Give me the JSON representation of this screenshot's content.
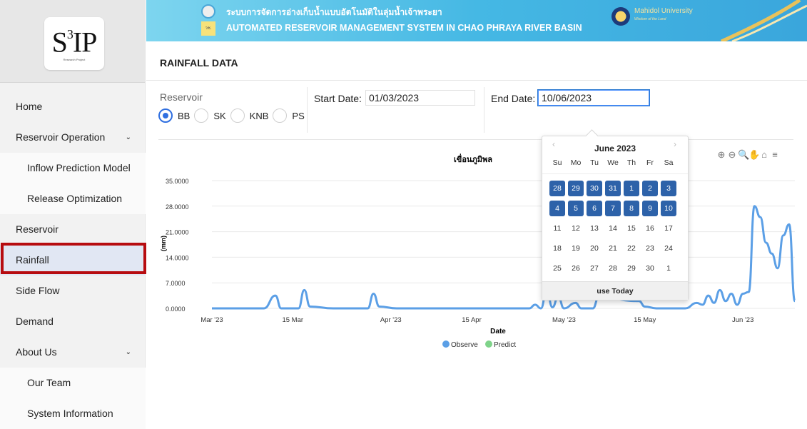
{
  "sidebar": {
    "logo_main": "S",
    "logo_sup": "3",
    "logo_rest": "IP",
    "logo_sub": "Research Project",
    "items": [
      {
        "label": "Home"
      },
      {
        "label": "Reservoir Operation",
        "chevron": "chevron-down-icon"
      },
      {
        "label": "Inflow Prediction Model"
      },
      {
        "label": "Release Optimization"
      },
      {
        "label": "Reservoir"
      },
      {
        "label": "Rainfall"
      },
      {
        "label": "Side Flow"
      },
      {
        "label": "Demand"
      },
      {
        "label": "About Us",
        "chevron": "chevron-down-icon"
      },
      {
        "label": "Our Team"
      },
      {
        "label": "System Information"
      }
    ],
    "active_item": "Rainfall",
    "highlight_color": "#b70c10"
  },
  "banner": {
    "title_th": "ระบบการจัดการอ่างเก็บน้ำแบบอัตโนมัติในลุ่มน้ำเจ้าพระยา",
    "title_en": "AUTOMATED RESERVOIR MANAGEMENT SYSTEM IN CHAO PHRAYA RIVER BASIN",
    "university": "Mahidol University",
    "university_sub": "Wisdom of the Land",
    "seal_text": "วช."
  },
  "page": {
    "title": "RAINFALL DATA"
  },
  "filters": {
    "reservoir_label": "Reservoir",
    "reservoirs": [
      "BB",
      "SK",
      "KNB",
      "PS"
    ],
    "selected_reservoir": "BB",
    "start_label": "Start Date:",
    "start_value": "01/03/2023",
    "end_label": "End Date:",
    "end_value": "10/06/2023"
  },
  "calendar": {
    "month_label": "June 2023",
    "prev": "‹",
    "next": "›",
    "weekdays": [
      "Su",
      "Mo",
      "Tu",
      "We",
      "Th",
      "Fr",
      "Sa"
    ],
    "days": [
      {
        "d": "28",
        "sel": true
      },
      {
        "d": "29",
        "sel": true
      },
      {
        "d": "30",
        "sel": true
      },
      {
        "d": "31",
        "sel": true
      },
      {
        "d": "1",
        "sel": true
      },
      {
        "d": "2",
        "sel": true
      },
      {
        "d": "3",
        "sel": true
      },
      {
        "d": "4",
        "sel": true
      },
      {
        "d": "5",
        "sel": true
      },
      {
        "d": "6",
        "sel": true
      },
      {
        "d": "7",
        "sel": true
      },
      {
        "d": "8",
        "sel": true
      },
      {
        "d": "9",
        "sel": true
      },
      {
        "d": "10",
        "sel": true
      },
      {
        "d": "11"
      },
      {
        "d": "12"
      },
      {
        "d": "13"
      },
      {
        "d": "14"
      },
      {
        "d": "15"
      },
      {
        "d": "16"
      },
      {
        "d": "17"
      },
      {
        "d": "18"
      },
      {
        "d": "19"
      },
      {
        "d": "20"
      },
      {
        "d": "21"
      },
      {
        "d": "22"
      },
      {
        "d": "23"
      },
      {
        "d": "24"
      },
      {
        "d": "25"
      },
      {
        "d": "26"
      },
      {
        "d": "27"
      },
      {
        "d": "28"
      },
      {
        "d": "29"
      },
      {
        "d": "30"
      },
      {
        "d": "1"
      }
    ],
    "today_label": "use Today",
    "selected_color": "#2d62a9"
  },
  "toolbar": {
    "icons": [
      "zoom-in-icon",
      "zoom-out-icon",
      "magnifier-icon",
      "pan-hand-icon",
      "home-icon",
      "menu-icon"
    ],
    "glyphs": [
      "⊕",
      "⊖",
      "🔍",
      "✋",
      "⌂",
      "≡"
    ]
  },
  "chart_data": {
    "type": "line",
    "title": "เขื่อนภูมิพล",
    "xlabel": "Date",
    "ylabel": "(mm)",
    "ylim": [
      0,
      35
    ],
    "yticks": [
      0,
      7,
      14,
      21,
      28,
      35
    ],
    "ytick_labels": [
      "0.0000",
      "7.0000",
      "14.0000",
      "21.0000",
      "28.0000",
      "35.0000"
    ],
    "xticks": [
      "2023-03-01",
      "2023-03-15",
      "2023-04-01",
      "2023-04-15",
      "2023-05-01",
      "2023-05-15",
      "2023-06-01"
    ],
    "xtick_labels": [
      "Mar '23",
      "15 Mar",
      "Apr '23",
      "15 Apr",
      "May '23",
      "15 May",
      "Jun '23"
    ],
    "xlim": [
      "2023-03-01",
      "2023-06-10"
    ],
    "legend": [
      "Observe",
      "Predict"
    ],
    "legend_colors": [
      "#5b9fe6",
      "#7fd38a"
    ],
    "legend_position": "bottom-center",
    "series": [
      {
        "name": "Observe",
        "color": "#5b9fe6",
        "points": [
          [
            "2023-03-01",
            0
          ],
          [
            "2023-03-05",
            0
          ],
          [
            "2023-03-10",
            0
          ],
          [
            "2023-03-12",
            3.5
          ],
          [
            "2023-03-13",
            0
          ],
          [
            "2023-03-16",
            0
          ],
          [
            "2023-03-17",
            5
          ],
          [
            "2023-03-18",
            0.5
          ],
          [
            "2023-03-22",
            0
          ],
          [
            "2023-03-28",
            0
          ],
          [
            "2023-03-29",
            4
          ],
          [
            "2023-03-30",
            0.5
          ],
          [
            "2023-04-02",
            0
          ],
          [
            "2023-04-18",
            0
          ],
          [
            "2023-04-25",
            0
          ],
          [
            "2023-04-26",
            1
          ],
          [
            "2023-04-27",
            0
          ],
          [
            "2023-04-28",
            5
          ],
          [
            "2023-04-29",
            0.3
          ],
          [
            "2023-04-30",
            3.2
          ],
          [
            "2023-05-01",
            0
          ],
          [
            "2023-05-03",
            1.5
          ],
          [
            "2023-05-04",
            0
          ],
          [
            "2023-05-06",
            0
          ],
          [
            "2023-05-07",
            3
          ],
          [
            "2023-05-14",
            2
          ],
          [
            "2023-05-15",
            0.5
          ],
          [
            "2023-05-17",
            0
          ],
          [
            "2023-05-22",
            0
          ],
          [
            "2023-05-24",
            1.5
          ],
          [
            "2023-05-25",
            1
          ],
          [
            "2023-05-26",
            3.5
          ],
          [
            "2023-05-27",
            1.5
          ],
          [
            "2023-05-28",
            5
          ],
          [
            "2023-05-29",
            2
          ],
          [
            "2023-05-30",
            4
          ],
          [
            "2023-05-31",
            1
          ],
          [
            "2023-06-01",
            4
          ],
          [
            "2023-06-02",
            4.5
          ],
          [
            "2023-06-03",
            28
          ],
          [
            "2023-06-04",
            25
          ],
          [
            "2023-06-05",
            18
          ],
          [
            "2023-06-06",
            15
          ],
          [
            "2023-06-07",
            11
          ],
          [
            "2023-06-08",
            20
          ],
          [
            "2023-06-09",
            23
          ],
          [
            "2023-06-10",
            2
          ]
        ]
      }
    ]
  }
}
